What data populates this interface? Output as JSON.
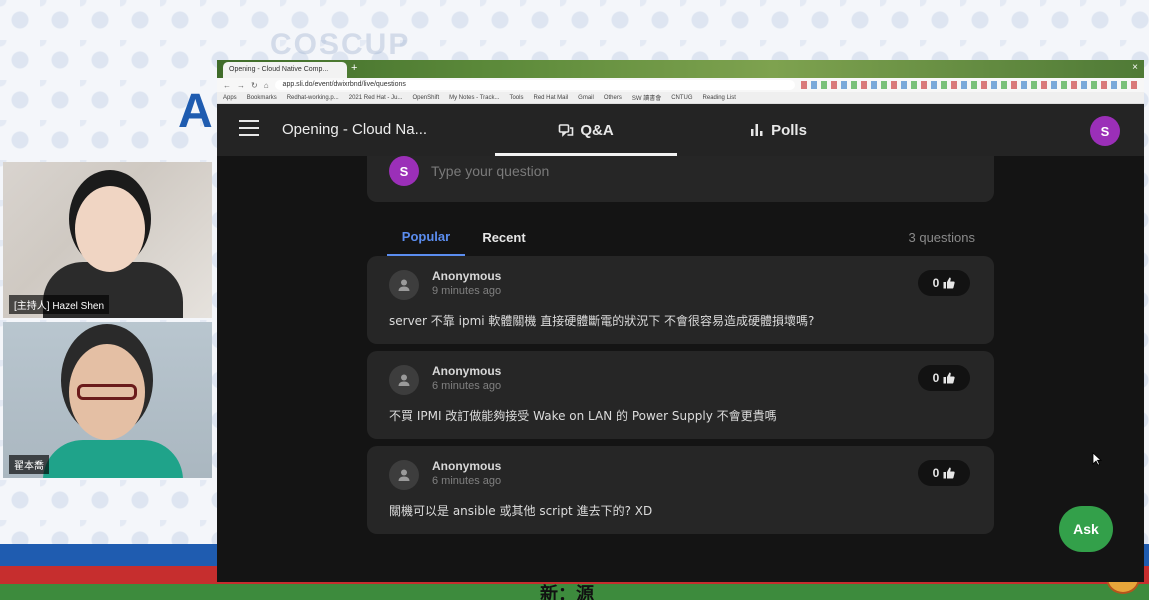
{
  "overlay": {
    "big_letter": "A",
    "bottom_caption": "新：源",
    "watermark": "COSCUP"
  },
  "webcams": [
    {
      "name_tag": "[主持人] Hazel Shen"
    },
    {
      "name_tag": "翟本喬"
    }
  ],
  "browser": {
    "tab_title": "Opening - Cloud Native Comp...",
    "new_tab": "+",
    "close": "×",
    "url": "app.sli.do/event/dwixrbnd/live/questions",
    "nav": {
      "back": "←",
      "forward": "→",
      "reload": "↻",
      "home": "⌂"
    },
    "bookmarks": [
      "Apps",
      "Bookmarks",
      "Redhat-working.p...",
      "2021 Red Hat - Ju...",
      "OpenShift",
      "My Notes - Track...",
      "Tools",
      "Red Hat Mail",
      "Gmail",
      "Others",
      "SW 讀書會",
      "CNTUG",
      "Reading List"
    ]
  },
  "app": {
    "event_title": "Opening - Cloud Na...",
    "tabs": {
      "qa": "Q&A",
      "polls": "Polls"
    },
    "user_initial": "S",
    "ask_placeholder": "Type your question",
    "question_tabs": {
      "popular": "Popular",
      "recent": "Recent"
    },
    "question_count": "3 questions",
    "questions": [
      {
        "author": "Anonymous",
        "time": "9 minutes ago",
        "likes": "0",
        "text": "server 不靠 ipmi 軟體關機 直接硬體斷電的狀況下 不會很容易造成硬體損壞嗎?"
      },
      {
        "author": "Anonymous",
        "time": "6 minutes ago",
        "likes": "0",
        "text": "不買 IPMI 改訂做能夠接受 Wake on LAN 的 Power Supply 不會更貴嗎"
      },
      {
        "author": "Anonymous",
        "time": "6 minutes ago",
        "likes": "0",
        "text": "關機可以是 ansible 或其他 script 進去下的? XD"
      }
    ],
    "ask_button": "Ask"
  },
  "colors": {
    "accent_blue": "#5b8def",
    "avatar_purple": "#9b2fb8",
    "ask_green": "#33a04a",
    "card_bg": "#262626"
  },
  "icons": [
    "menu-icon",
    "qa-chat-icon",
    "polls-bar-icon",
    "person-icon",
    "thumbs-up-icon",
    "mouse-cursor-icon"
  ]
}
